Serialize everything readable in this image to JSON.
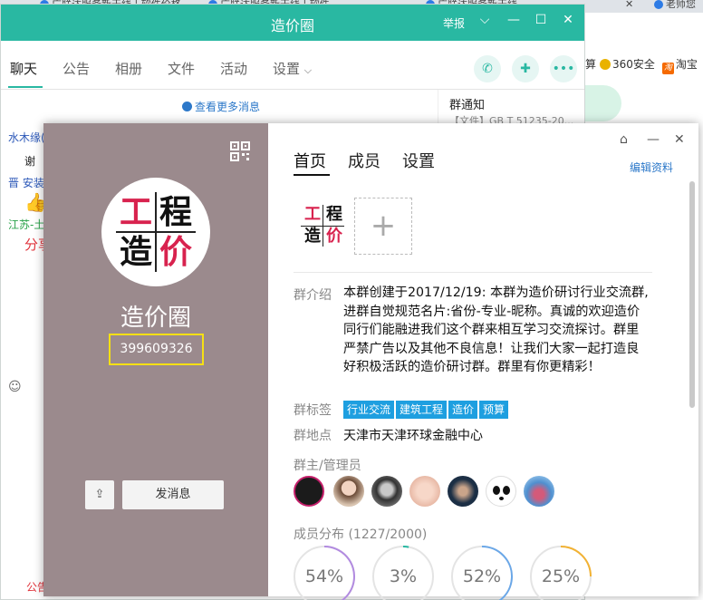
{
  "browser": {
    "tabs": [
      {
        "label": "广联达服务新干线 | 软件价格..."
      },
      {
        "label": "广联达服务新干线 | 软件..."
      },
      {
        "label": "广联达服务新干线"
      },
      {
        "label": "老师您"
      }
    ],
    "bookmarks": [
      {
        "label": "算"
      },
      {
        "label": "360安全",
        "icon": "360-icon"
      },
      {
        "label": "淘宝",
        "icon": "taobao-icon"
      }
    ]
  },
  "chat": {
    "title": "造价圈",
    "report_label": "举报",
    "tabs": [
      {
        "label": "聊天",
        "active": true
      },
      {
        "label": "公告"
      },
      {
        "label": "相册"
      },
      {
        "label": "文件"
      },
      {
        "label": "活动"
      },
      {
        "label": "设置"
      }
    ],
    "more_messages": "查看更多消息",
    "notice": {
      "title": "群通知",
      "file": "【文件】GB T 51235-20..."
    },
    "fragments": [
      "水木缘(",
      "谢",
      "晋 安装",
      "江苏-土",
      "分享"
    ],
    "bottom_fragment": "公告"
  },
  "dialog": {
    "group_name": "造价圈",
    "group_number": "399609326",
    "logo_chars": [
      "工",
      "程",
      "造",
      "价"
    ],
    "send_button": "发消息",
    "tabs": [
      {
        "label": "首页",
        "active": true
      },
      {
        "label": "成员"
      },
      {
        "label": "设置"
      }
    ],
    "edit_link": "编辑资料",
    "add_photo_symbol": "+",
    "intro_label": "群介绍",
    "intro_text": "本群创建于2017/12/19:  本群为造价研讨行业交流群,进群自觉规范名片:省份-专业-昵称。真诚的欢迎造价同行们能融进我们这个群来相互学习交流探讨。群里严禁广告以及其他不良信息！让我们大家一起打造良好积极活跃的造价研讨群。群里有你更精彩！",
    "tags_label": "群标签",
    "tags": [
      "行业交流",
      "建筑工程",
      "造价",
      "预算"
    ],
    "location_label": "群地点",
    "location": "天津市天津环球金融中心",
    "admin_label": "群主/管理员",
    "admin_count": 7,
    "distribution_label": "成员分布",
    "distribution_count": "(1227/2000)",
    "distribution": [
      {
        "label": "54%",
        "value": 54,
        "color": "#b28be0"
      },
      {
        "label": "3%",
        "value": 3,
        "color": "#29b8a2"
      },
      {
        "label": "52%",
        "value": 52,
        "color": "#6aa7e8"
      },
      {
        "label": "25%",
        "value": 25,
        "color": "#f2b233"
      }
    ],
    "colors": {
      "sidebar": "#9b8a8d",
      "accent": "#29b8a2",
      "tag": "#1e9fe0",
      "highlight": "#f5e014",
      "logo_red": "#d8224e"
    }
  }
}
